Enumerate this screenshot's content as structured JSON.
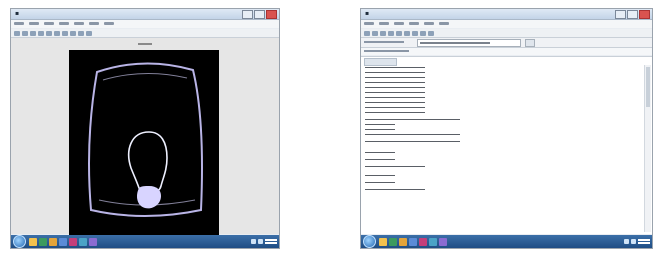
{
  "icons": {
    "figure_window": "figure-window-icon",
    "editor_window": "editor-window-icon",
    "start": "windows-start-icon",
    "taskbar_apps": [
      "explorer-icon",
      "media-icon",
      "folder-icon",
      "app-icon",
      "matlab-icon",
      "app-icon",
      "app-icon"
    ]
  },
  "colors": {
    "taskbar": "#1f4d84",
    "titlebar": "#c3d4e8",
    "figure_background": "#000000",
    "contour": "#e9ecff",
    "blob": "#d8d4ff"
  },
  "taskbar_app_colors": [
    "#f2c14e",
    "#3c9a5f",
    "#e2a43b",
    "#5b8bd6",
    "#c33f7a",
    "#4aa3c6",
    "#8a6bd1"
  ]
}
